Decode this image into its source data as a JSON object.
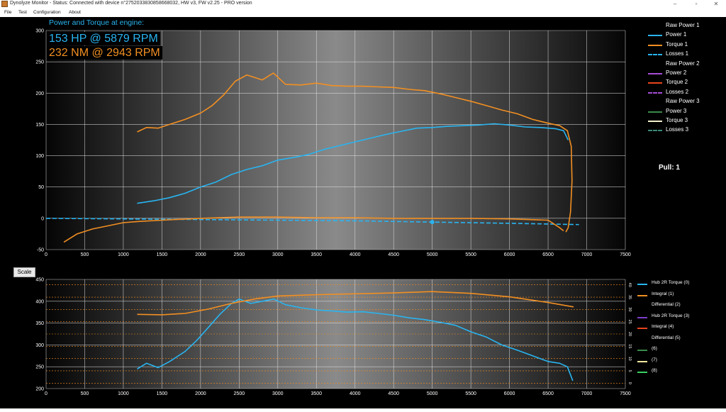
{
  "window": {
    "title": "Dynolyze Monitor - Status: Connected with device n°275203383085866803​2, HW v3, FW v2.25 - PRO version",
    "controls": [
      "–",
      "▫",
      "✕"
    ]
  },
  "menu": [
    "File",
    "Test",
    "Configuration",
    "About"
  ],
  "annotations": {
    "title": "Power and Torque at engine:",
    "power": "153 HP @ 5879 RPM",
    "torque": "232 NM @ 2943 RPM"
  },
  "legend_top": {
    "items": [
      {
        "label": "Raw Power 1",
        "color": "",
        "style": "none"
      },
      {
        "label": "Power 1",
        "color": "#29b4f0",
        "style": "solid"
      },
      {
        "label": "Torque 1",
        "color": "#f28f22",
        "style": "solid"
      },
      {
        "label": "Losses 1",
        "color": "#29b4f0",
        "style": "dashed"
      },
      {
        "label": "Raw Power 2",
        "color": "",
        "style": "none"
      },
      {
        "label": "Power 2",
        "color": "#a64dd6",
        "style": "solid"
      },
      {
        "label": "Torque 2",
        "color": "#e8441c",
        "style": "solid"
      },
      {
        "label": "Losses 2",
        "color": "#a64dd6",
        "style": "dashed"
      },
      {
        "label": "Raw Power 3",
        "color": "",
        "style": "none"
      },
      {
        "label": "Power 3",
        "color": "#3a8a4a",
        "style": "solid"
      },
      {
        "label": "Torque 3",
        "color": "#f4f0d0",
        "style": "solid"
      },
      {
        "label": "Losses 3",
        "color": "#3a8a7a",
        "style": "dashed"
      }
    ]
  },
  "pull_label": "Pull: 1",
  "scale_button": "Scale",
  "legend_bottom": {
    "items": [
      {
        "label": "Hub 2R Torque (0)",
        "color": "#29b4f0"
      },
      {
        "label": "Integral (1)",
        "color": "#f28f22"
      },
      {
        "label": "Differential (2)",
        "color": ""
      },
      {
        "label": "Hub 2R Torque (3)",
        "color": "#7a3fc8"
      },
      {
        "label": "Integral (4)",
        "color": "#e8441c"
      },
      {
        "label": "Differential (5)",
        "color": ""
      },
      {
        "label": "(6)",
        "color": "#3a8a4a"
      },
      {
        "label": "(7)",
        "color": "#f0e8a0"
      },
      {
        "label": "(8)",
        "color": "#3ad060"
      }
    ]
  },
  "chart_data": [
    {
      "type": "line",
      "x_ticks": [
        0,
        500,
        1000,
        1500,
        2000,
        2500,
        3000,
        3500,
        4000,
        4500,
        5000,
        5500,
        6000,
        6500,
        7000,
        7500
      ],
      "y_ticks": [
        -50,
        0,
        50,
        100,
        150,
        200,
        250,
        300
      ],
      "xlim": [
        0,
        7500
      ],
      "ylim": [
        -50,
        300
      ],
      "grid": true,
      "series": [
        {
          "name": "Power 1",
          "color": "#29b4f0",
          "style": "solid",
          "x": [
            1180,
            1400,
            1600,
            1800,
            2000,
            2200,
            2400,
            2600,
            2800,
            3000,
            3200,
            3400,
            3600,
            3800,
            4000,
            4200,
            4400,
            4600,
            4800,
            5000,
            5200,
            5400,
            5600,
            5800,
            6000,
            6200,
            6400,
            6600,
            6700,
            6760
          ],
          "y": [
            24,
            28,
            33,
            40,
            50,
            58,
            70,
            78,
            84,
            93,
            97,
            102,
            110,
            116,
            122,
            128,
            134,
            139,
            144,
            145,
            147,
            148,
            149,
            151,
            149,
            146,
            145,
            143,
            140,
            125
          ]
        },
        {
          "name": "Torque 1",
          "color": "#f28f22",
          "style": "solid",
          "x": [
            1180,
            1300,
            1450,
            1600,
            1800,
            2000,
            2150,
            2300,
            2450,
            2600,
            2800,
            2943,
            3100,
            3300,
            3500,
            3700,
            3900,
            4100,
            4300,
            4500,
            4700,
            4900,
            5100,
            5300,
            5500,
            5700,
            5900,
            6100,
            6300,
            6500,
            6650,
            6750,
            6800,
            6810,
            6790,
            6760,
            6730
          ],
          "y": [
            138,
            145,
            144,
            150,
            158,
            168,
            180,
            197,
            219,
            229,
            221,
            232,
            214,
            213,
            216,
            212,
            211,
            211,
            210,
            209,
            206,
            204,
            199,
            193,
            187,
            180,
            173,
            167,
            158,
            152,
            148,
            140,
            115,
            60,
            10,
            -15,
            -22
          ]
        },
        {
          "name": "Losses 1",
          "color": "#29b4f0",
          "style": "dashed",
          "x": [
            0,
            1000,
            2000,
            3000,
            4000,
            5000,
            6000,
            6900
          ],
          "y": [
            0,
            -1,
            -2,
            -3,
            -4,
            -6,
            -8,
            -10
          ]
        },
        {
          "name": "Raw Power 1",
          "color": "#f28f22",
          "style": "solid",
          "x": [
            230,
            400,
            600,
            800,
            1000,
            1200,
            1500,
            2000,
            2500,
            3000,
            3500,
            4000,
            4500,
            5000,
            5500,
            6000,
            6500,
            6650,
            6700
          ],
          "y": [
            -38,
            -25,
            -17,
            -12,
            -7,
            -5,
            -3,
            0,
            2,
            2,
            1,
            1,
            0,
            0,
            0,
            -1,
            -3,
            -15,
            -20
          ]
        }
      ]
    },
    {
      "type": "line",
      "x_ticks": [
        0,
        500,
        1000,
        1500,
        2000,
        2500,
        3000,
        3500,
        4000,
        4500,
        5000,
        5500,
        6000,
        6500,
        7000,
        7500
      ],
      "y_ticks": [
        200,
        250,
        300,
        350,
        400,
        450
      ],
      "xlim": [
        0,
        7500
      ],
      "ylim": [
        200,
        450
      ],
      "y2_ticks": [
        0,
        5,
        10,
        15,
        20,
        25,
        30,
        35,
        40
      ],
      "grid": true,
      "series": [
        {
          "name": "Hub 2R Torque (0)",
          "color": "#29b4f0",
          "style": "solid",
          "x": [
            1180,
            1300,
            1450,
            1600,
            1800,
            1950,
            2100,
            2250,
            2400,
            2500,
            2650,
            2800,
            2950,
            3100,
            3300,
            3500,
            3700,
            3900,
            4100,
            4300,
            4500,
            4700,
            4900,
            5100,
            5300,
            5500,
            5700,
            5900,
            6100,
            6300,
            6500,
            6650,
            6750,
            6820
          ],
          "y": [
            245,
            258,
            248,
            262,
            285,
            310,
            340,
            370,
            395,
            405,
            395,
            400,
            405,
            392,
            385,
            380,
            378,
            375,
            376,
            372,
            368,
            362,
            358,
            352,
            345,
            330,
            318,
            300,
            288,
            275,
            262,
            258,
            250,
            218
          ]
        },
        {
          "name": "Integral (1)",
          "color": "#f28f22",
          "style": "solid",
          "x": [
            1180,
            1500,
            1800,
            2100,
            2400,
            2700,
            3000,
            3500,
            4000,
            4500,
            5000,
            5500,
            6000,
            6500,
            6830
          ],
          "y": [
            370,
            369,
            372,
            382,
            395,
            405,
            412,
            415,
            417,
            419,
            422,
            418,
            410,
            397,
            387
          ]
        }
      ]
    }
  ]
}
